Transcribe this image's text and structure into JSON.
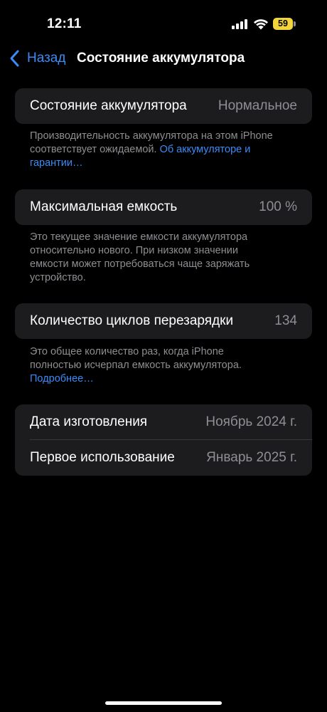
{
  "status_bar": {
    "time": "12:11",
    "battery_percent": "59",
    "battery_color": "#f2d43c"
  },
  "nav": {
    "back_label": "Назад",
    "title": "Состояние аккумулятора"
  },
  "sections": {
    "health": {
      "label": "Состояние аккумулятора",
      "value": "Нормальное",
      "footnote_text": "Производительность аккумулятора на этом iPhone соответствует ожидаемой. ",
      "footnote_link": "Об аккумуля­торе и гарантии…"
    },
    "capacity": {
      "label": "Максимальная емкость",
      "value": "100 %",
      "footnote_text": "Это текущее значение емкости аккумулятора относительно нового. При низком значении емкости может потребоваться чаще заряжать устройство."
    },
    "cycles": {
      "label": "Количество циклов перезарядки",
      "value": "134",
      "footnote_text": "Это общее количество раз, когда iPhone полностью исчерпал емкость аккумулятора.",
      "footnote_link": "Подробнее…"
    },
    "dates": {
      "manufacture_label": "Дата изготовления",
      "manufacture_value": "Ноябрь 2024 г.",
      "first_use_label": "Первое использование",
      "first_use_value": "Январь 2025 г."
    }
  },
  "colors": {
    "accent": "#3a8cf6",
    "card_background": "#1c1c1e",
    "secondary_text": "#8e8e93"
  }
}
